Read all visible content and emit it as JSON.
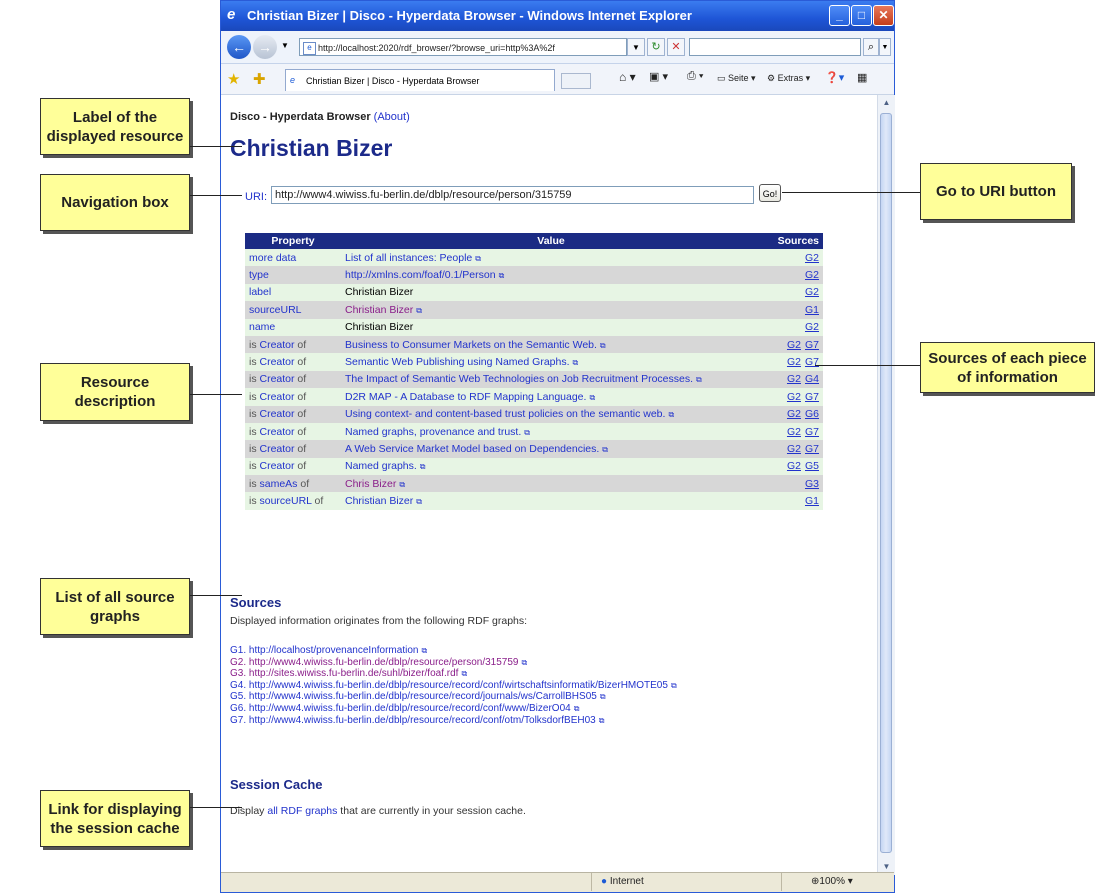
{
  "window": {
    "title": "Christian Bizer | Disco - Hyperdata Browser - Windows Internet Explorer",
    "address": "http://localhost:2020/rdf_browser/?browse_uri=http%3A%2f",
    "tab_label": "Christian Bizer | Disco - Hyperdata Browser",
    "commands": {
      "page": "Seite",
      "extras": "Extras"
    },
    "status": {
      "zone": "Internet",
      "zoom": "100%"
    }
  },
  "page": {
    "app_name": "Disco - Hyperdata Browser",
    "about_link": "(About)",
    "title": "Christian Bizer",
    "uri_label": "URI:",
    "uri_value": "http://www4.wiwiss.fu-berlin.de/dblp/resource/person/315759",
    "go_button": "Go!"
  },
  "table": {
    "headers": [
      "Property",
      "Value",
      "Sources"
    ],
    "rows": [
      {
        "prefix": "",
        "property": "more data",
        "suffix": "",
        "value": "List of all instances: People",
        "value_style": "link",
        "ext": true,
        "sources": [
          "G2"
        ]
      },
      {
        "prefix": "",
        "property": "type",
        "suffix": "",
        "value": "http://xmlns.com/foaf/0.1/Person",
        "value_style": "link",
        "ext": true,
        "sources": [
          "G2"
        ]
      },
      {
        "prefix": "",
        "property": "label",
        "suffix": "",
        "value": "Christian Bizer",
        "value_style": "plain",
        "ext": false,
        "sources": [
          "G2"
        ]
      },
      {
        "prefix": "",
        "property": "sourceURL",
        "suffix": "",
        "value": "Christian Bizer",
        "value_style": "visited",
        "ext": true,
        "sources": [
          "G1"
        ]
      },
      {
        "prefix": "",
        "property": "name",
        "suffix": "",
        "value": "Christian Bizer",
        "value_style": "plain",
        "ext": false,
        "sources": [
          "G2"
        ]
      },
      {
        "prefix": "is ",
        "property": "Creator",
        "suffix": " of",
        "value": "Business to Consumer Markets on the Semantic Web.",
        "value_style": "link",
        "ext": true,
        "sources": [
          "G2",
          "G7"
        ]
      },
      {
        "prefix": "is ",
        "property": "Creator",
        "suffix": " of",
        "value": "Semantic Web Publishing using Named Graphs.",
        "value_style": "link",
        "ext": true,
        "sources": [
          "G2",
          "G7"
        ]
      },
      {
        "prefix": "is ",
        "property": "Creator",
        "suffix": " of",
        "value": "The Impact of Semantic Web Technologies on Job Recruitment Processes.",
        "value_style": "link",
        "ext": true,
        "sources": [
          "G2",
          "G4"
        ]
      },
      {
        "prefix": "is ",
        "property": "Creator",
        "suffix": " of",
        "value": "D2R MAP - A Database to RDF Mapping Language.",
        "value_style": "link",
        "ext": true,
        "sources": [
          "G2",
          "G7"
        ]
      },
      {
        "prefix": "is ",
        "property": "Creator",
        "suffix": " of",
        "value": "Using context- and content-based trust policies on the semantic web.",
        "value_style": "link",
        "ext": true,
        "sources": [
          "G2",
          "G6"
        ]
      },
      {
        "prefix": "is ",
        "property": "Creator",
        "suffix": " of",
        "value": "Named graphs, provenance and trust.",
        "value_style": "link",
        "ext": true,
        "sources": [
          "G2",
          "G7"
        ]
      },
      {
        "prefix": "is ",
        "property": "Creator",
        "suffix": " of",
        "value": "A Web Service Market Model based on Dependencies.",
        "value_style": "link",
        "ext": true,
        "sources": [
          "G2",
          "G7"
        ]
      },
      {
        "prefix": "is ",
        "property": "Creator",
        "suffix": " of",
        "value": "Named graphs.",
        "value_style": "link",
        "ext": true,
        "sources": [
          "G2",
          "G5"
        ]
      },
      {
        "prefix": "is ",
        "property": "sameAs",
        "suffix": " of",
        "value": "Chris Bizer",
        "value_style": "visited",
        "ext": true,
        "sources": [
          "G3"
        ]
      },
      {
        "prefix": "is ",
        "property": "sourceURL",
        "suffix": " of",
        "value": "Christian Bizer",
        "value_style": "link",
        "ext": true,
        "sources": [
          "G1"
        ]
      }
    ]
  },
  "sources": {
    "heading": "Sources",
    "intro": "Displayed information originates from the following RDF graphs:",
    "graphs": [
      {
        "text": "G1. http://localhost/provenanceInformation",
        "color": "#2233cc"
      },
      {
        "text": "G2. http://www4.wiwiss.fu-berlin.de/dblp/resource/person/315759",
        "color": "#8a1e8a"
      },
      {
        "text": "G3. http://sites.wiwiss.fu-berlin.de/suhl/bizer/foaf.rdf",
        "color": "#8a1e8a"
      },
      {
        "text": "G4. http://www4.wiwiss.fu-berlin.de/dblp/resource/record/conf/wirtschaftsinformatik/BizerHMOTE05",
        "color": "#2233cc"
      },
      {
        "text": "G5. http://www4.wiwiss.fu-berlin.de/dblp/resource/record/journals/ws/CarrollBHS05",
        "color": "#2233cc"
      },
      {
        "text": "G6. http://www4.wiwiss.fu-berlin.de/dblp/resource/record/conf/www/BizerO04",
        "color": "#2233cc"
      },
      {
        "text": "G7. http://www4.wiwiss.fu-berlin.de/dblp/resource/record/conf/otm/TolksdorfBEH03",
        "color": "#2233cc"
      }
    ]
  },
  "cache": {
    "heading": "Session Cache",
    "text_before": "Display ",
    "link": "all RDF graphs",
    "text_after": " that are currently in your session cache."
  },
  "callouts": {
    "label": "Label of the displayed resource",
    "nav": "Navigation box",
    "go": "Go to URI button",
    "sources_each": "Sources of each piece of information",
    "resource_desc": "Resource description",
    "list_graphs": "List of all source graphs",
    "session_link": "Link for displaying the session cache"
  }
}
